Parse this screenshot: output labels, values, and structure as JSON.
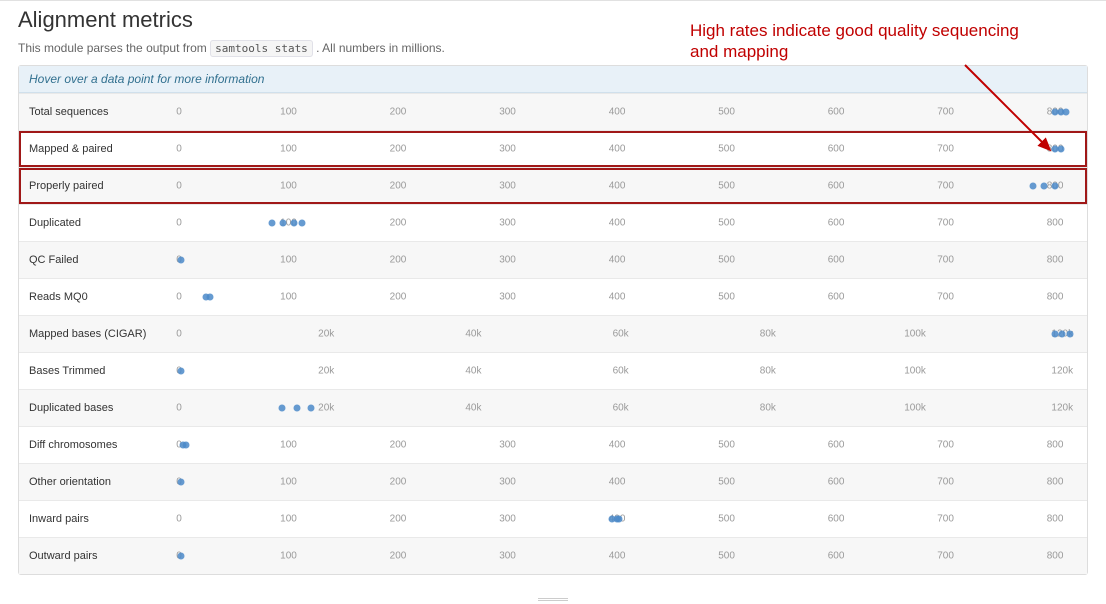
{
  "header": {
    "title": "Alignment metrics",
    "subtitle_prefix": "This module parses the output from ",
    "subtitle_code": "samtools stats",
    "subtitle_suffix": " . All numbers in millions."
  },
  "banner": {
    "text": "Hover over a data point for more information"
  },
  "annotation": {
    "text": "High rates indicate good quality sequencing and mapping"
  },
  "rows": [
    {
      "label": "Total sequences",
      "scale": "reads",
      "highlight": false,
      "points": [
        800,
        805,
        810
      ]
    },
    {
      "label": "Mapped & paired",
      "scale": "reads",
      "highlight": true,
      "points": [
        800,
        805
      ]
    },
    {
      "label": "Properly paired",
      "scale": "reads",
      "highlight": true,
      "points": [
        780,
        790,
        800
      ]
    },
    {
      "label": "Duplicated",
      "scale": "reads",
      "highlight": false,
      "points": [
        85,
        95,
        105,
        112
      ]
    },
    {
      "label": "QC Failed",
      "scale": "reads",
      "highlight": false,
      "points": [
        2
      ]
    },
    {
      "label": "Reads MQ0",
      "scale": "reads",
      "highlight": false,
      "points": [
        25,
        28
      ]
    },
    {
      "label": "Mapped bases (CIGAR)",
      "scale": "bases",
      "highlight": false,
      "points": [
        119000,
        120000,
        121000
      ]
    },
    {
      "label": "Bases Trimmed",
      "scale": "bases",
      "highlight": false,
      "points": [
        300
      ]
    },
    {
      "label": "Duplicated bases",
      "scale": "bases",
      "highlight": false,
      "points": [
        14000,
        16000,
        18000
      ]
    },
    {
      "label": "Diff chromosomes",
      "scale": "reads",
      "highlight": false,
      "points": [
        4,
        6
      ]
    },
    {
      "label": "Other orientation",
      "scale": "reads",
      "highlight": false,
      "points": [
        2
      ]
    },
    {
      "label": "Inward pairs",
      "scale": "reads",
      "highlight": false,
      "points": [
        395,
        400,
        402
      ]
    },
    {
      "label": "Outward pairs",
      "scale": "reads",
      "highlight": false,
      "points": [
        2
      ]
    }
  ],
  "scales": {
    "reads": {
      "max": 820,
      "ticks": [
        0,
        100,
        200,
        300,
        400,
        500,
        600,
        700,
        800
      ]
    },
    "bases": {
      "max": 122000,
      "ticks": [
        0,
        20000,
        40000,
        60000,
        80000,
        100000,
        120000
      ],
      "labelfmt": "k"
    }
  },
  "chart_data": {
    "type": "scatter",
    "title": "Alignment metrics",
    "note": "All numbers in millions",
    "series": [
      {
        "name": "Total sequences",
        "unit": "reads (millions)",
        "values": [
          800,
          805,
          810
        ]
      },
      {
        "name": "Mapped & paired",
        "unit": "reads (millions)",
        "values": [
          800,
          805
        ]
      },
      {
        "name": "Properly paired",
        "unit": "reads (millions)",
        "values": [
          780,
          790,
          800
        ]
      },
      {
        "name": "Duplicated",
        "unit": "reads (millions)",
        "values": [
          85,
          95,
          105,
          112
        ]
      },
      {
        "name": "QC Failed",
        "unit": "reads (millions)",
        "values": [
          2
        ]
      },
      {
        "name": "Reads MQ0",
        "unit": "reads (millions)",
        "values": [
          25,
          28
        ]
      },
      {
        "name": "Mapped bases (CIGAR)",
        "unit": "bases (millions)",
        "values": [
          119000,
          120000,
          121000
        ]
      },
      {
        "name": "Bases Trimmed",
        "unit": "bases (millions)",
        "values": [
          300
        ]
      },
      {
        "name": "Duplicated bases",
        "unit": "bases (millions)",
        "values": [
          14000,
          16000,
          18000
        ]
      },
      {
        "name": "Diff chromosomes",
        "unit": "reads (millions)",
        "values": [
          4,
          6
        ]
      },
      {
        "name": "Other orientation",
        "unit": "reads (millions)",
        "values": [
          2
        ]
      },
      {
        "name": "Inward pairs",
        "unit": "reads (millions)",
        "values": [
          395,
          400,
          402
        ]
      },
      {
        "name": "Outward pairs",
        "unit": "reads (millions)",
        "values": [
          2
        ]
      }
    ],
    "x_axes": {
      "reads": {
        "range": [
          0,
          800
        ],
        "ticks": [
          0,
          100,
          200,
          300,
          400,
          500,
          600,
          700,
          800
        ]
      },
      "bases": {
        "range": [
          0,
          120000
        ],
        "ticks": [
          0,
          20000,
          40000,
          60000,
          80000,
          100000,
          120000
        ],
        "tick_labels": [
          "0",
          "20k",
          "40k",
          "60k",
          "80k",
          "100k",
          "120k"
        ]
      }
    }
  }
}
